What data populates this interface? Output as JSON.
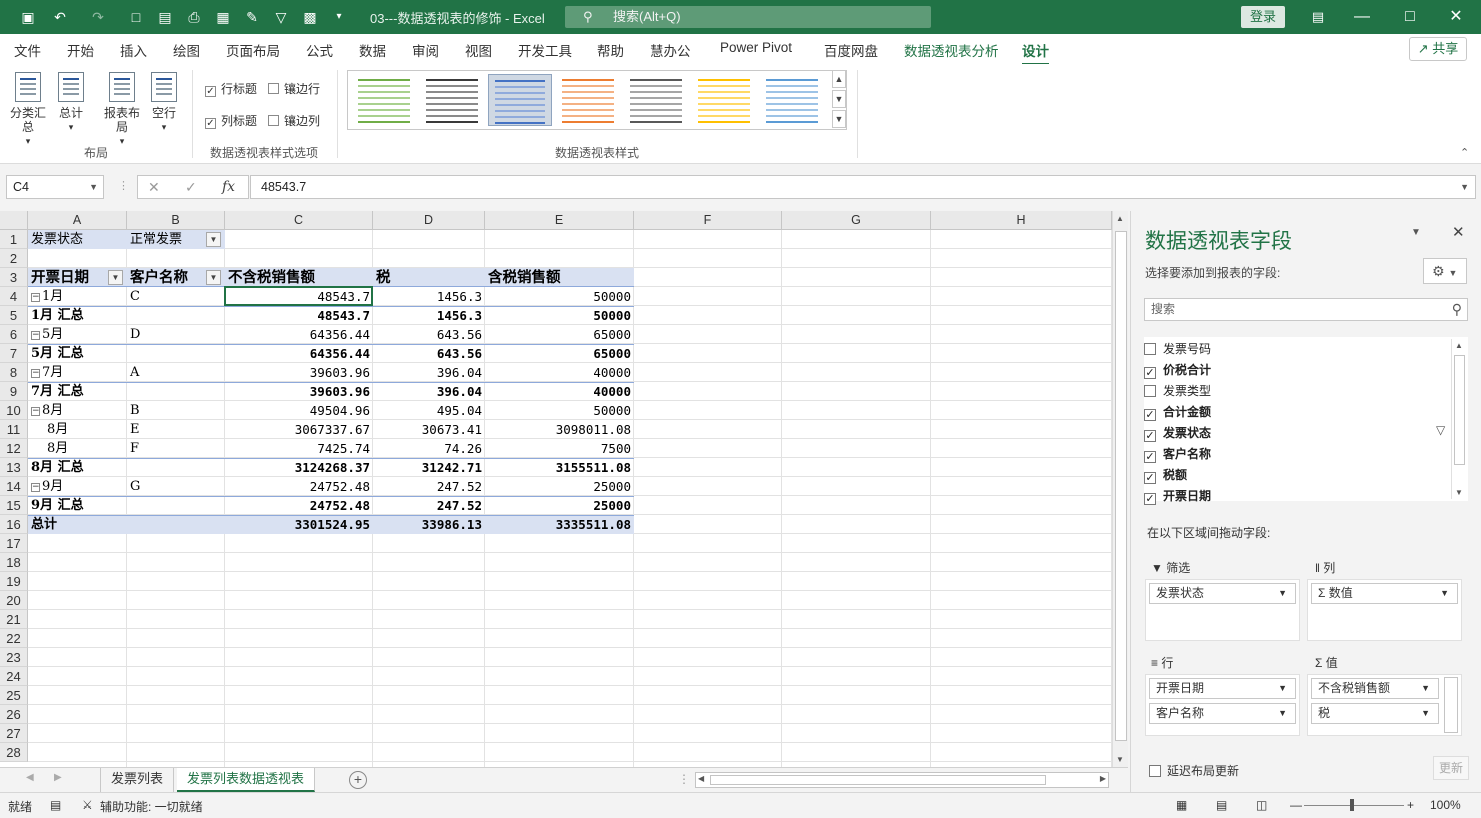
{
  "titlebar": {
    "title": "03---数据透视表的修饰  -  Excel",
    "search_placeholder": "搜索(Alt+Q)",
    "login": "登录"
  },
  "menu": {
    "tabs": [
      "文件",
      "开始",
      "插入",
      "绘图",
      "页面布局",
      "公式",
      "数据",
      "审阅",
      "视图",
      "开发工具",
      "帮助",
      "慧办公",
      "Power Pivot",
      "百度网盘",
      "数据透视表分析",
      "设计"
    ],
    "share": "共享"
  },
  "ribbon": {
    "layout_buttons": [
      "分类汇总",
      "总计",
      "报表布局",
      "空行"
    ],
    "layout_group": "布局",
    "options": {
      "row_headers": "行标题",
      "col_headers": "列标题",
      "banded_rows": "镶边行",
      "banded_cols": "镶边列"
    },
    "options_group": "数据透视表样式选项",
    "styles_group": "数据透视表样式"
  },
  "formula_bar": {
    "name_box": "C4",
    "fx": "fx",
    "value": "48543.7"
  },
  "sheet": {
    "columns": [
      "A",
      "B",
      "C",
      "D",
      "E",
      "F",
      "G",
      "H"
    ],
    "rows": [
      "1",
      "2",
      "3",
      "4",
      "5",
      "6",
      "7",
      "8",
      "9",
      "10",
      "11",
      "12",
      "13",
      "14",
      "15",
      "16",
      "17",
      "18",
      "19",
      "20",
      "21",
      "22",
      "23",
      "24",
      "25",
      "26",
      "27",
      "28"
    ],
    "filter_label": "发票状态",
    "filter_value": "正常发票",
    "headers": [
      "开票日期",
      "客户名称",
      "不含税销售额",
      "税",
      "含税销售额"
    ],
    "data_rows": [
      {
        "a": "1月",
        "b": "C",
        "c": "48543.7",
        "d": "1456.3",
        "e": "50000",
        "kind": "item"
      },
      {
        "a": "1月 汇总",
        "b": "",
        "c": "48543.7",
        "d": "1456.3",
        "e": "50000",
        "kind": "subtotal"
      },
      {
        "a": "5月",
        "b": "D",
        "c": "64356.44",
        "d": "643.56",
        "e": "65000",
        "kind": "item"
      },
      {
        "a": "5月 汇总",
        "b": "",
        "c": "64356.44",
        "d": "643.56",
        "e": "65000",
        "kind": "subtotal"
      },
      {
        "a": "7月",
        "b": "A",
        "c": "39603.96",
        "d": "396.04",
        "e": "40000",
        "kind": "item"
      },
      {
        "a": "7月 汇总",
        "b": "",
        "c": "39603.96",
        "d": "396.04",
        "e": "40000",
        "kind": "subtotal"
      },
      {
        "a": "8月",
        "b": "B",
        "c": "49504.96",
        "d": "495.04",
        "e": "50000",
        "kind": "item"
      },
      {
        "a": "8月",
        "b": "E",
        "c": "3067337.67",
        "d": "30673.41",
        "e": "3098011.08",
        "kind": "repeat"
      },
      {
        "a": "8月",
        "b": "F",
        "c": "7425.74",
        "d": "74.26",
        "e": "7500",
        "kind": "repeat"
      },
      {
        "a": "8月 汇总",
        "b": "",
        "c": "3124268.37",
        "d": "31242.71",
        "e": "3155511.08",
        "kind": "subtotal"
      },
      {
        "a": "9月",
        "b": "G",
        "c": "24752.48",
        "d": "247.52",
        "e": "25000",
        "kind": "item"
      },
      {
        "a": "9月 汇总",
        "b": "",
        "c": "24752.48",
        "d": "247.52",
        "e": "25000",
        "kind": "subtotal"
      },
      {
        "a": "总计",
        "b": "",
        "c": "3301524.95",
        "d": "33986.13",
        "e": "3335511.08",
        "kind": "total"
      }
    ]
  },
  "sheet_tabs": [
    "发票列表",
    "发票列表数据透视表"
  ],
  "statusbar": {
    "ready": "就绪",
    "accessibility": "辅助功能: 一切就绪",
    "zoom": "100%"
  },
  "pivot_pane": {
    "title": "数据透视表字段",
    "subtitle": "选择要添加到报表的字段:",
    "search_placeholder": "搜索",
    "fields": [
      {
        "name": "发票号码",
        "checked": false
      },
      {
        "name": "价税合计",
        "checked": true
      },
      {
        "name": "发票类型",
        "checked": false
      },
      {
        "name": "合计金额",
        "checked": true
      },
      {
        "name": "发票状态",
        "checked": true
      },
      {
        "name": "客户名称",
        "checked": true
      },
      {
        "name": "税额",
        "checked": true
      },
      {
        "name": "开票日期",
        "checked": true
      }
    ],
    "drag_label": "在以下区域间拖动字段:",
    "areas": {
      "filter": {
        "label": "筛选",
        "items": [
          "发票状态"
        ]
      },
      "columns": {
        "label": "列",
        "items": [
          "数值"
        ]
      },
      "rows": {
        "label": "行",
        "items": [
          "开票日期",
          "客户名称"
        ]
      },
      "values": {
        "label": "值",
        "items": [
          "不含税销售额",
          "税"
        ]
      }
    },
    "defer": "延迟布局更新",
    "update": "更新"
  }
}
